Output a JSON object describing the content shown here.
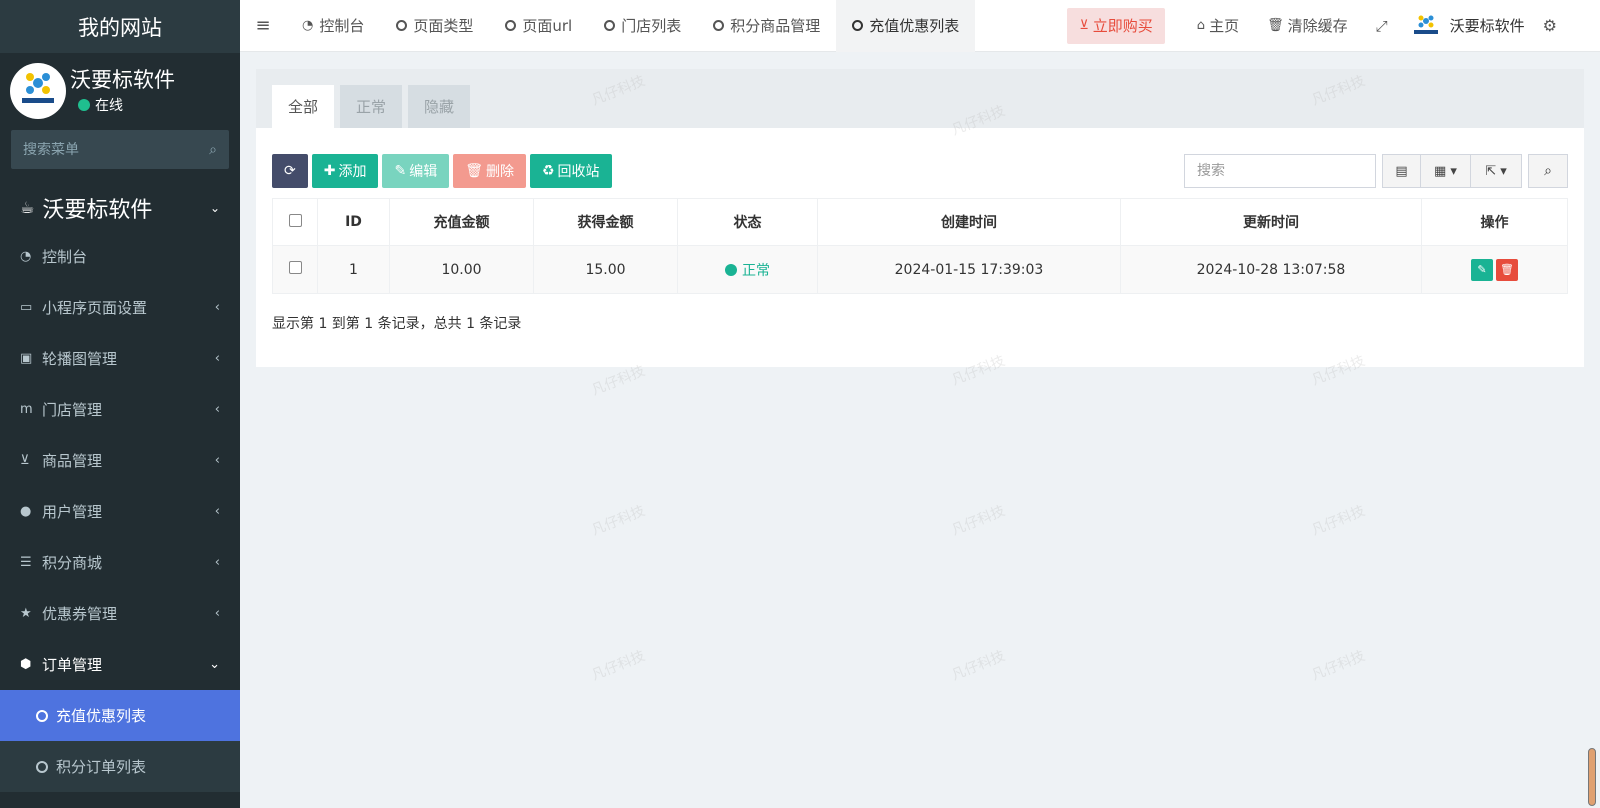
{
  "sidebar": {
    "site_title": "我的网站",
    "user_name": "沃要标软件",
    "user_status": "在线",
    "search_placeholder": "搜索菜单",
    "header": "沃要标软件",
    "items": [
      {
        "label": "控制台",
        "icon": "dashboard-icon"
      },
      {
        "label": "小程序页面设置",
        "icon": "folder-icon"
      },
      {
        "label": "轮播图管理",
        "icon": "image-icon"
      },
      {
        "label": "门店管理",
        "icon": "store-icon"
      },
      {
        "label": "商品管理",
        "icon": "cart-icon"
      },
      {
        "label": "用户管理",
        "icon": "user-icon"
      },
      {
        "label": "积分商城",
        "icon": "list-icon"
      },
      {
        "label": "优惠券管理",
        "icon": "star-icon"
      },
      {
        "label": "订单管理",
        "icon": "cube-icon"
      }
    ],
    "subitems": [
      {
        "label": "充值优惠列表"
      },
      {
        "label": "积分订单列表"
      }
    ]
  },
  "topbar": {
    "tabs": [
      {
        "label": "控制台"
      },
      {
        "label": "页面类型"
      },
      {
        "label": "页面url"
      },
      {
        "label": "门店列表"
      },
      {
        "label": "积分商品管理"
      },
      {
        "label": "充值优惠列表"
      }
    ],
    "buy_label": "立即购买",
    "home_label": "主页",
    "clear_cache_label": "清除缓存",
    "brand_label": "沃要标软件",
    "accent_color": "#4e73df"
  },
  "panel": {
    "tabs": [
      {
        "label": "全部"
      },
      {
        "label": "正常"
      },
      {
        "label": "隐藏"
      }
    ],
    "toolbar": {
      "add": "添加",
      "edit": "编辑",
      "delete": "删除",
      "recycle": "回收站",
      "search_placeholder": "搜索"
    },
    "table": {
      "headers": [
        "ID",
        "充值金额",
        "获得金额",
        "状态",
        "创建时间",
        "更新时间",
        "操作"
      ],
      "rows": [
        {
          "id": "1",
          "amount": "10.00",
          "bonus": "15.00",
          "status": "正常",
          "created": "2024-01-15 17:39:03",
          "updated": "2024-10-28 13:07:58"
        }
      ]
    },
    "pager": "显示第 1 到第 1 条记录，总共 1 条记录"
  },
  "watermark": "凡仔科技"
}
